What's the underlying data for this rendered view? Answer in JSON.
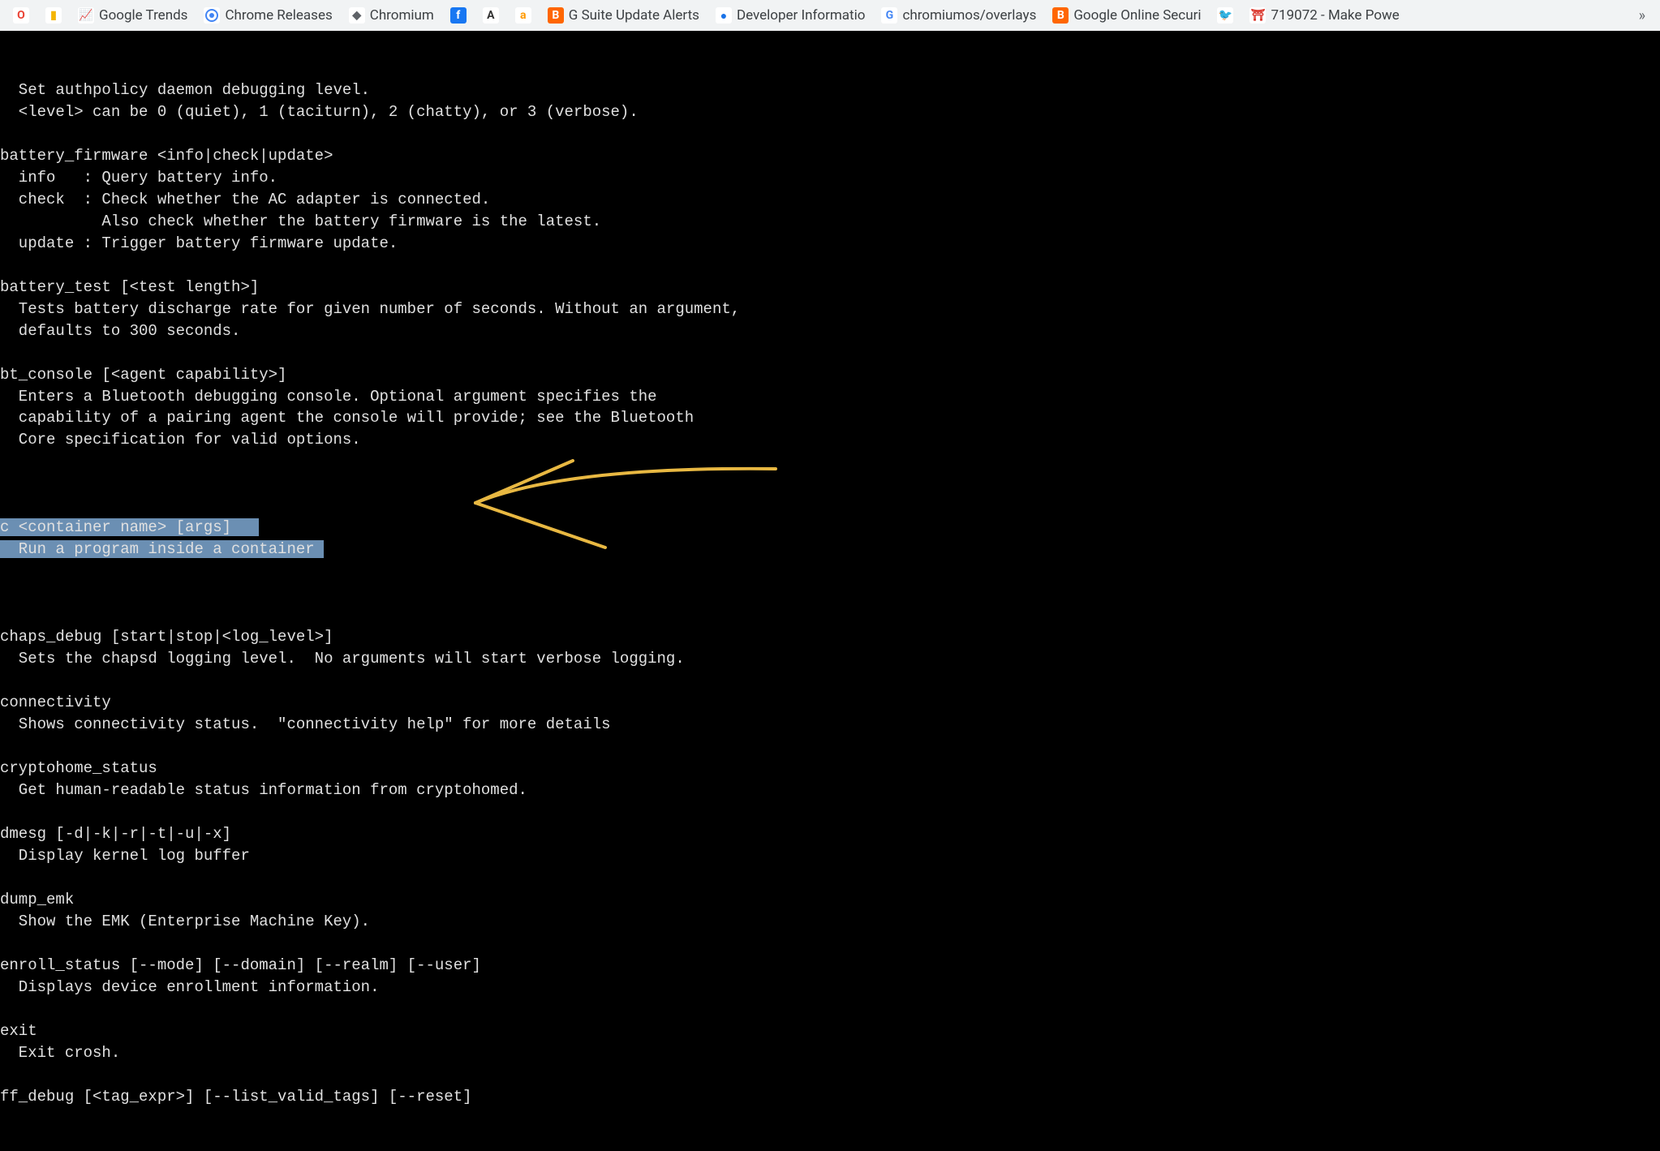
{
  "bookmarks": [
    {
      "label": "",
      "icon": "O",
      "iconBg": "#fff",
      "iconColor": "#ea4335"
    },
    {
      "label": "",
      "icon": "▮",
      "iconBg": "#fff",
      "iconColor": "#f4b400"
    },
    {
      "label": "Google Trends",
      "icon": "📈",
      "iconBg": "#fff"
    },
    {
      "label": "Chrome Releases",
      "icon": "●",
      "iconBg": "#fff",
      "iconCircle": true
    },
    {
      "label": "Chromium",
      "icon": "◆",
      "iconBg": "#fff",
      "iconColor": "#5f6368"
    },
    {
      "label": "",
      "icon": "f",
      "iconBg": "#1877f2",
      "iconColor": "#fff"
    },
    {
      "label": "",
      "icon": "A",
      "iconBg": "#fff",
      "iconColor": "#333"
    },
    {
      "label": "",
      "icon": "a",
      "iconBg": "#fff",
      "iconColor": "#ff9900"
    },
    {
      "label": "G Suite Update Alerts",
      "icon": "B",
      "iconBg": "#ff6600",
      "iconColor": "#fff"
    },
    {
      "label": "Developer Informatio",
      "icon": "●",
      "iconBg": "#fff",
      "iconColor": "#1a73e8"
    },
    {
      "label": "chromiumos/overlays",
      "icon": "G",
      "iconBg": "#fff",
      "iconColor": "#4285f4"
    },
    {
      "label": "Google Online Securi",
      "icon": "B",
      "iconBg": "#ff6600",
      "iconColor": "#fff"
    },
    {
      "label": "",
      "icon": "🐦",
      "iconBg": "#fff",
      "iconColor": "#1da1f2"
    },
    {
      "label": "719072 - Make Powe",
      "icon": "⛩",
      "iconBg": "#fff",
      "iconColor": "#d93025"
    }
  ],
  "overflow_label": "»",
  "terminal": {
    "lines": [
      "  Set authpolicy daemon debugging level.",
      "  <level> can be 0 (quiet), 1 (taciturn), 2 (chatty), or 3 (verbose).",
      "",
      "battery_firmware <info|check|update>",
      "  info   : Query battery info.",
      "  check  : Check whether the AC adapter is connected.",
      "           Also check whether the battery firmware is the latest.",
      "  update : Trigger battery firmware update.",
      "",
      "battery_test [<test length>]",
      "  Tests battery discharge rate for given number of seconds. Without an argument,",
      "  defaults to 300 seconds.",
      "",
      "bt_console [<agent capability>]",
      "  Enters a Bluetooth debugging console. Optional argument specifies the",
      "  capability of a pairing agent the console will provide; see the Bluetooth",
      "  Core specification for valid options.",
      ""
    ],
    "highlighted_lines": [
      "c <container name> [args]   ",
      "  Run a program inside a container "
    ],
    "lines_after": [
      "",
      "chaps_debug [start|stop|<log_level>]",
      "  Sets the chapsd logging level.  No arguments will start verbose logging.",
      "",
      "connectivity",
      "  Shows connectivity status.  \"connectivity help\" for more details",
      "",
      "cryptohome_status",
      "  Get human-readable status information from cryptohomed.",
      "",
      "dmesg [-d|-k|-r|-t|-u|-x]",
      "  Display kernel log buffer",
      "",
      "dump_emk",
      "  Show the EMK (Enterprise Machine Key).",
      "",
      "enroll_status [--mode] [--domain] [--realm] [--user]",
      "  Displays device enrollment information.",
      "",
      "exit",
      "  Exit crosh.",
      "",
      "ff_debug [<tag_expr>] [--list_valid_tags] [--reset]"
    ]
  },
  "annotation_color": "#e8b842"
}
